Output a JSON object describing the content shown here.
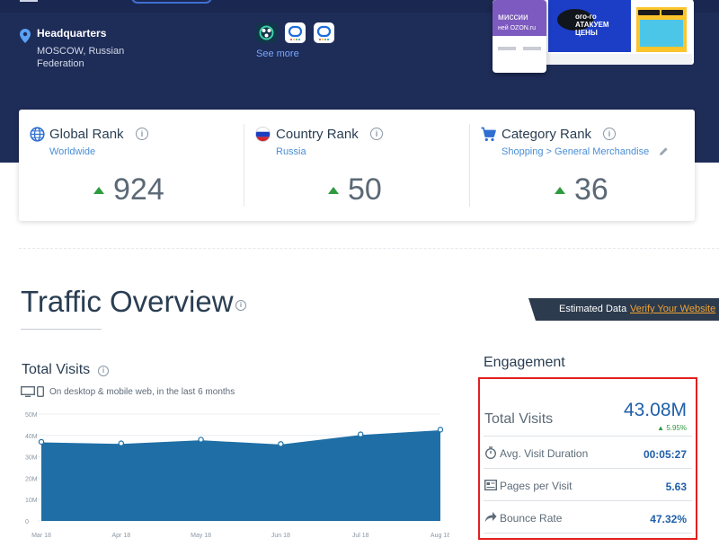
{
  "headquarters": {
    "title": "Headquarters",
    "value": "MOSCOW, Russian Federation"
  },
  "apps": {
    "see_more": "See more"
  },
  "store_preview": {
    "banner_text_1": "миссии",
    "banner_text_2": "ней OZON.ru",
    "promo_text": "ого-го АТАКУЕМ ЦЕНЫ"
  },
  "ranks": [
    {
      "title": "Global Rank",
      "sub": "Worldwide",
      "value": "924"
    },
    {
      "title": "Country Rank",
      "sub": "Russia",
      "value": "50"
    },
    {
      "title": "Category Rank",
      "sub": "Shopping > General Merchandise",
      "value": "36"
    }
  ],
  "traffic_overview": {
    "title": "Traffic Overview",
    "estimated_label": "Estimated Data",
    "verify_link": "Verify Your Website"
  },
  "total_visits_chart": {
    "title": "Total Visits",
    "subtitle": "On desktop & mobile web, in the last 6 months"
  },
  "chart_data": {
    "type": "area",
    "x": [
      "Mar 18",
      "Apr 18",
      "May 18",
      "Jun 18",
      "Jul 18",
      "Aug 18"
    ],
    "y_ticks": [
      "50M",
      "40M",
      "30M",
      "20M",
      "10M",
      "0"
    ],
    "ylim": [
      0,
      50000000
    ],
    "series": [
      {
        "values": [
          37000000,
          36300000,
          38000000,
          36000000,
          40500000,
          42700000
        ]
      }
    ],
    "color": "#1f6fa6"
  },
  "engagement": {
    "title": "Engagement",
    "total_visits_label": "Total Visits",
    "total_visits_value": "43.08M",
    "total_visits_change": "5.95%",
    "rows": [
      {
        "label": "Avg. Visit Duration",
        "value": "00:05:27"
      },
      {
        "label": "Pages per Visit",
        "value": "5.63"
      },
      {
        "label": "Bounce Rate",
        "value": "47.32%"
      }
    ]
  }
}
